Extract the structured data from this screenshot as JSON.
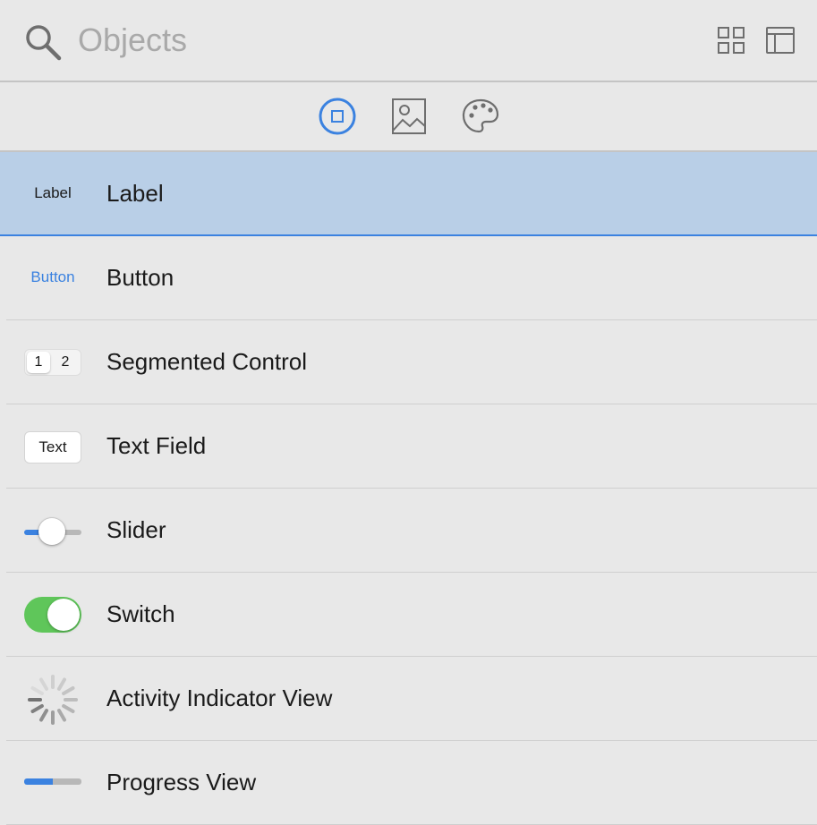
{
  "search": {
    "placeholder": "Objects",
    "value": ""
  },
  "toolbar": {
    "grid_view_icon": "grid-icon",
    "layout_view_icon": "sidebar-layout-icon"
  },
  "library_tabs": [
    {
      "icon": "objects-icon",
      "selected": true
    },
    {
      "icon": "image-icon",
      "selected": false
    },
    {
      "icon": "palette-icon",
      "selected": false
    }
  ],
  "colors": {
    "accent": "#3b82e0",
    "selection": "#b9cfe7",
    "switch_on": "#5fc65a",
    "background": "#e8e8e8"
  },
  "items": [
    {
      "title": "Label",
      "thumb_text": "Label",
      "selected": true
    },
    {
      "title": "Button",
      "thumb_text": "Button",
      "selected": false
    },
    {
      "title": "Segmented Control",
      "segments": [
        "1",
        "2"
      ],
      "selected_segment": 0,
      "selected": false
    },
    {
      "title": "Text Field",
      "thumb_text": "Text",
      "selected": false
    },
    {
      "title": "Slider",
      "value": 0.5,
      "selected": false
    },
    {
      "title": "Switch",
      "on": true,
      "selected": false
    },
    {
      "title": "Activity Indicator View",
      "selected": false
    },
    {
      "title": "Progress View",
      "value": 0.5,
      "selected": false
    }
  ]
}
